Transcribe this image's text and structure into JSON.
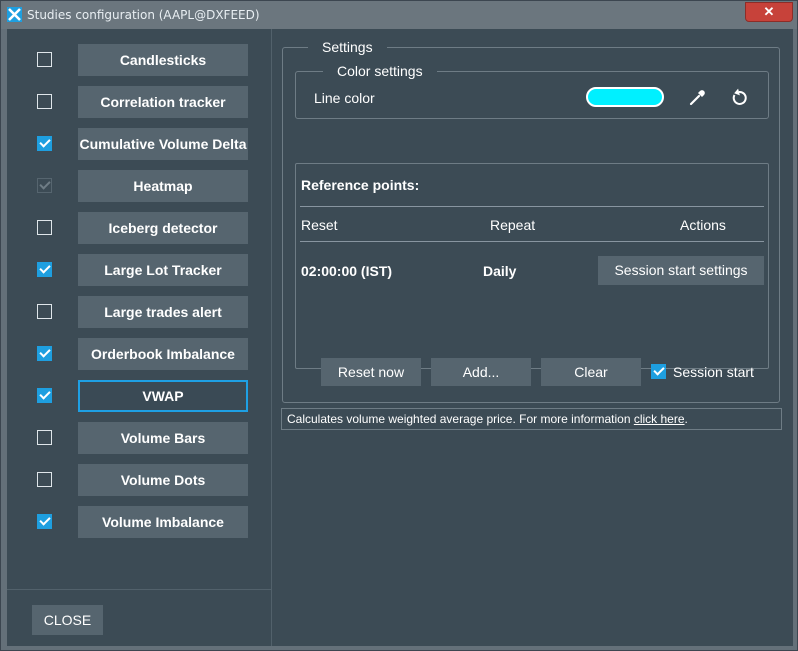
{
  "window": {
    "title": "Studies configuration (AAPL@DXFEED)",
    "close_glyph": "✕"
  },
  "studies": [
    {
      "label": "Candlesticks",
      "checked": false,
      "disabled": false,
      "selected": false
    },
    {
      "label": "Correlation tracker",
      "checked": false,
      "disabled": false,
      "selected": false
    },
    {
      "label": "Cumulative Volume Delta",
      "checked": true,
      "disabled": false,
      "selected": false
    },
    {
      "label": "Heatmap",
      "checked": true,
      "disabled": true,
      "selected": false
    },
    {
      "label": "Iceberg detector",
      "checked": false,
      "disabled": false,
      "selected": false
    },
    {
      "label": "Large Lot Tracker",
      "checked": true,
      "disabled": false,
      "selected": false
    },
    {
      "label": "Large trades alert",
      "checked": false,
      "disabled": false,
      "selected": false
    },
    {
      "label": "Orderbook Imbalance",
      "checked": true,
      "disabled": false,
      "selected": false
    },
    {
      "label": "VWAP",
      "checked": true,
      "disabled": false,
      "selected": true
    },
    {
      "label": "Volume Bars",
      "checked": false,
      "disabled": false,
      "selected": false
    },
    {
      "label": "Volume Dots",
      "checked": false,
      "disabled": false,
      "selected": false
    },
    {
      "label": "Volume Imbalance",
      "checked": true,
      "disabled": false,
      "selected": false
    }
  ],
  "close_button": "CLOSE",
  "settings": {
    "legend": "Settings",
    "color_settings": {
      "legend": "Color settings",
      "line_color_label": "Line color",
      "line_color_value": "#00f0ff",
      "icons": [
        "eyedropper-icon",
        "reset-icon"
      ]
    },
    "reference_points": {
      "title": "Reference points:",
      "columns": {
        "reset": "Reset",
        "repeat": "Repeat",
        "actions": "Actions"
      },
      "rows": [
        {
          "reset": "02:00:00 (IST)",
          "repeat": "Daily",
          "action": "Session start settings"
        }
      ]
    },
    "buttons": {
      "reset_now": "Reset now",
      "add": "Add...",
      "clear": "Clear",
      "session_start_label": "Session start",
      "session_start_checked": true
    }
  },
  "description": {
    "text": "Calculates volume weighted average price. For more information ",
    "link": "click here",
    "suffix": "."
  },
  "colors": {
    "accent": "#1e9fe0",
    "background": "#3c4b55",
    "button": "#56656f",
    "close": "#c7423a"
  }
}
